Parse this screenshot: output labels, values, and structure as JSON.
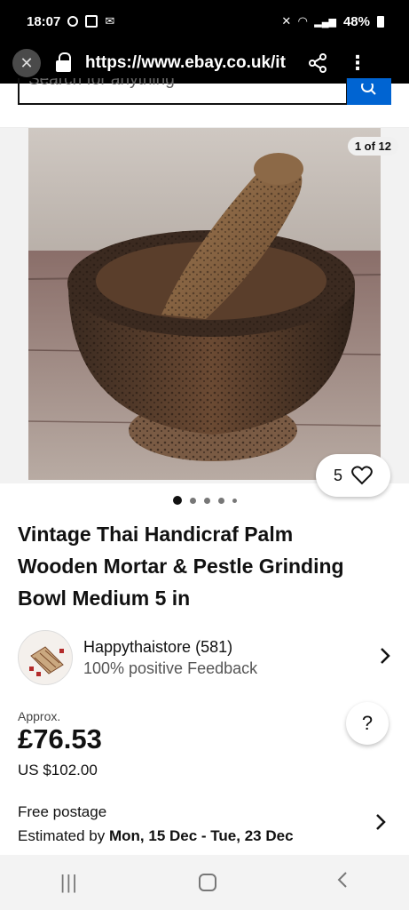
{
  "status": {
    "time": "18:07",
    "battery": "48%"
  },
  "browser": {
    "url": "https://www.ebay.co.uk/it",
    "close_symbol": "✕",
    "menu_symbol": "⋮"
  },
  "search": {
    "placeholder": "Search for anything"
  },
  "gallery": {
    "counter": "1 of 12",
    "watch_count": "5",
    "dots": 5,
    "active_dot": 0
  },
  "listing": {
    "title": "Vintage Thai Handicraf Palm Wooden Mortar & Pestle Grinding Bowl Medium 5 in"
  },
  "seller": {
    "name": "Happythaistore (581)",
    "feedback": "100% positive Feedback"
  },
  "price": {
    "approx_label": "Approx.",
    "gbp": "£76.53",
    "usd": "US $102.00",
    "help": "?"
  },
  "shipping": {
    "postage": "Free postage",
    "estimated_label": "Estimated by ",
    "estimated_dates": "Mon, 15 Dec - Tue, 23 Dec"
  },
  "icons": {
    "close": "close-icon",
    "lock": "lock-icon",
    "share": "share-icon",
    "menu": "more-vert-icon",
    "search": "search-icon",
    "heart": "heart-icon",
    "chevron": "chevron-right-icon"
  },
  "colors": {
    "accent": "#0064d2",
    "statusbar": "#000000"
  }
}
